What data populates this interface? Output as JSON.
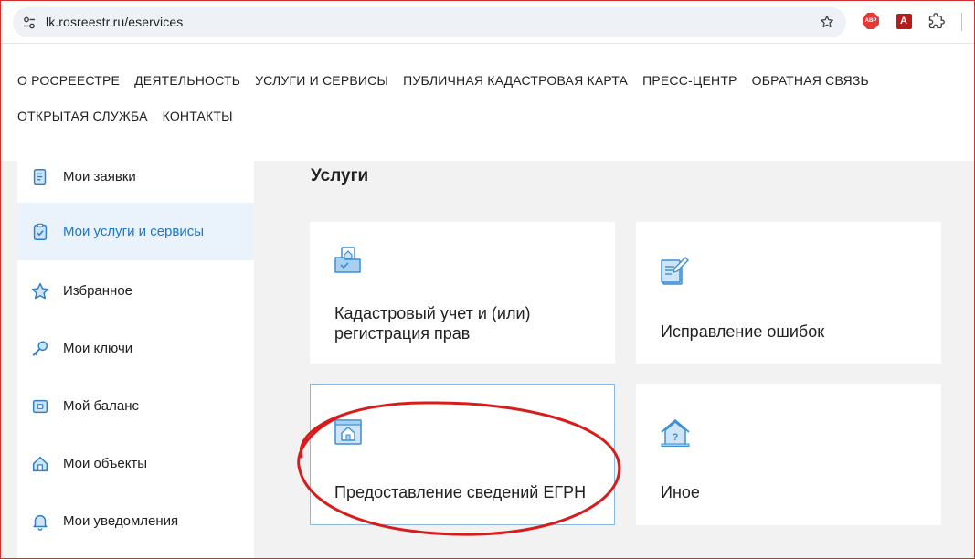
{
  "browser": {
    "url": "lk.rosreestr.ru/eservices",
    "extensions": [
      {
        "name": "abp",
        "label": "ABP"
      },
      {
        "name": "pdf",
        "label": "A"
      }
    ]
  },
  "topnav": {
    "row1": [
      "О РОСРЕЕСТРЕ",
      "ДЕЯТЕЛЬНОСТЬ",
      "УСЛУГИ И СЕРВИСЫ",
      "ПУБЛИЧНАЯ КАДАСТРОВАЯ КАРТА",
      "ПРЕСС-ЦЕНТР",
      "ОБРАТНАЯ СВЯЗЬ"
    ],
    "row2": [
      "ОТКРЫТАЯ СЛУЖБА",
      "КОНТАКТЫ"
    ]
  },
  "sidebar": {
    "items": [
      {
        "label": "Мои заявки",
        "icon": "document-icon",
        "active": false
      },
      {
        "label": "Мои услуги и сервисы",
        "icon": "clipboard-check-icon",
        "active": true
      },
      {
        "label": "Избранное",
        "icon": "star-icon",
        "active": false
      },
      {
        "label": "Мои ключи",
        "icon": "key-icon",
        "active": false
      },
      {
        "label": "Мой баланс",
        "icon": "wallet-icon",
        "active": false
      },
      {
        "label": "Мои объекты",
        "icon": "house-icon",
        "active": false
      },
      {
        "label": "Мои уведомления",
        "icon": "bell-icon",
        "active": false
      }
    ]
  },
  "services": {
    "title": "Услуги",
    "cards": [
      {
        "line1": "Кадастровый учет и (или)",
        "line2": "регистрация прав",
        "icon": "folder-house-icon"
      },
      {
        "line1": "Исправление ошибок",
        "line2": "",
        "icon": "edit-document-icon"
      },
      {
        "line1": "Предоставление сведений ЕГРН",
        "line2": "",
        "icon": "registry-house-icon"
      },
      {
        "line1": "Иное",
        "line2": "",
        "icon": "house-question-icon"
      }
    ]
  },
  "colors": {
    "accent": "#1976d2",
    "icon_blue": "#3a8fd6",
    "active_bg": "#eaf3fb",
    "annotation_red": "#d81b1b"
  }
}
